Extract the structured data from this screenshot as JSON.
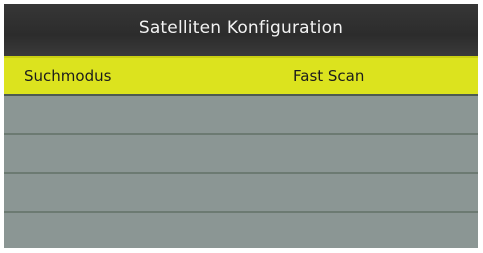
{
  "header": {
    "title": "Satelliten Konfiguration"
  },
  "menu": {
    "items": [
      {
        "label": "Suchmodus",
        "value": "Fast Scan",
        "selected": true
      }
    ]
  },
  "colors": {
    "highlight": "#dce31e",
    "header_bg": "#2f2f2f",
    "menu_bg": "#8c9795"
  }
}
